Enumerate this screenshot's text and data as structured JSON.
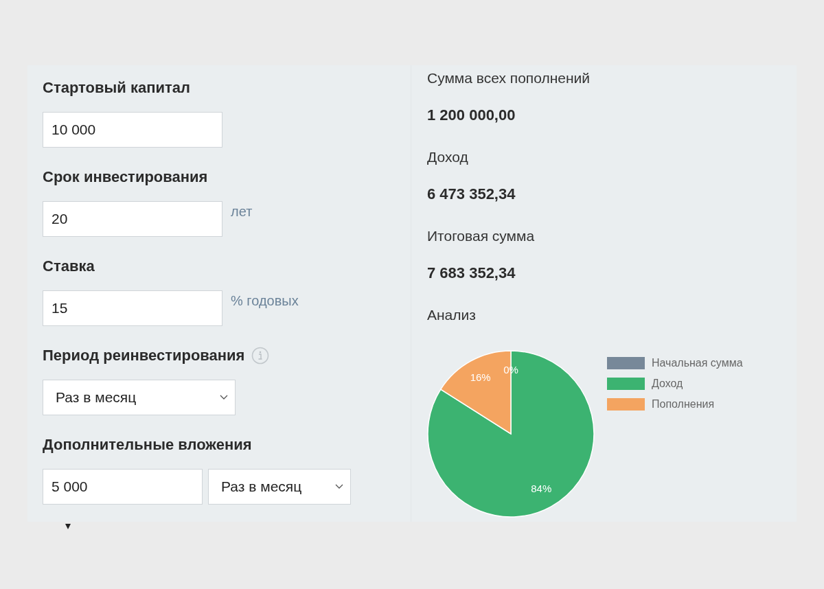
{
  "form": {
    "fields": [
      {
        "kind": "input",
        "label": "Стартовый капитал",
        "value": "10 000"
      },
      {
        "kind": "input",
        "label": "Срок инвестирования",
        "value": "20",
        "unit": "лет"
      },
      {
        "kind": "input",
        "label": "Ставка",
        "value": "15",
        "unit": "% годовых"
      },
      {
        "kind": "select",
        "label": "Период реинвестирования",
        "info": true,
        "value": "Раз в месяц"
      },
      {
        "kind": "input_select",
        "label": "Дополнительные вложения",
        "value": "5 000",
        "period": "Раз в месяц"
      }
    ]
  },
  "results": [
    {
      "label": "Сумма всех пополнений",
      "value": "1 200 000,00"
    },
    {
      "label": "Доход",
      "value": "6 473 352,34"
    },
    {
      "label": "Итоговая сумма",
      "value": "7 683 352,34"
    }
  ],
  "analysis": {
    "title": "Анализ",
    "chart_data": {
      "type": "pie",
      "categories": [
        "Начальная сумма",
        "Доход",
        "Пополнения"
      ],
      "values": [
        0,
        84,
        16
      ],
      "colors": [
        "#778899",
        "#3cb371",
        "#f4a460"
      ],
      "value_labels": [
        "0%",
        "84%",
        "16%"
      ],
      "legend": "right"
    }
  }
}
